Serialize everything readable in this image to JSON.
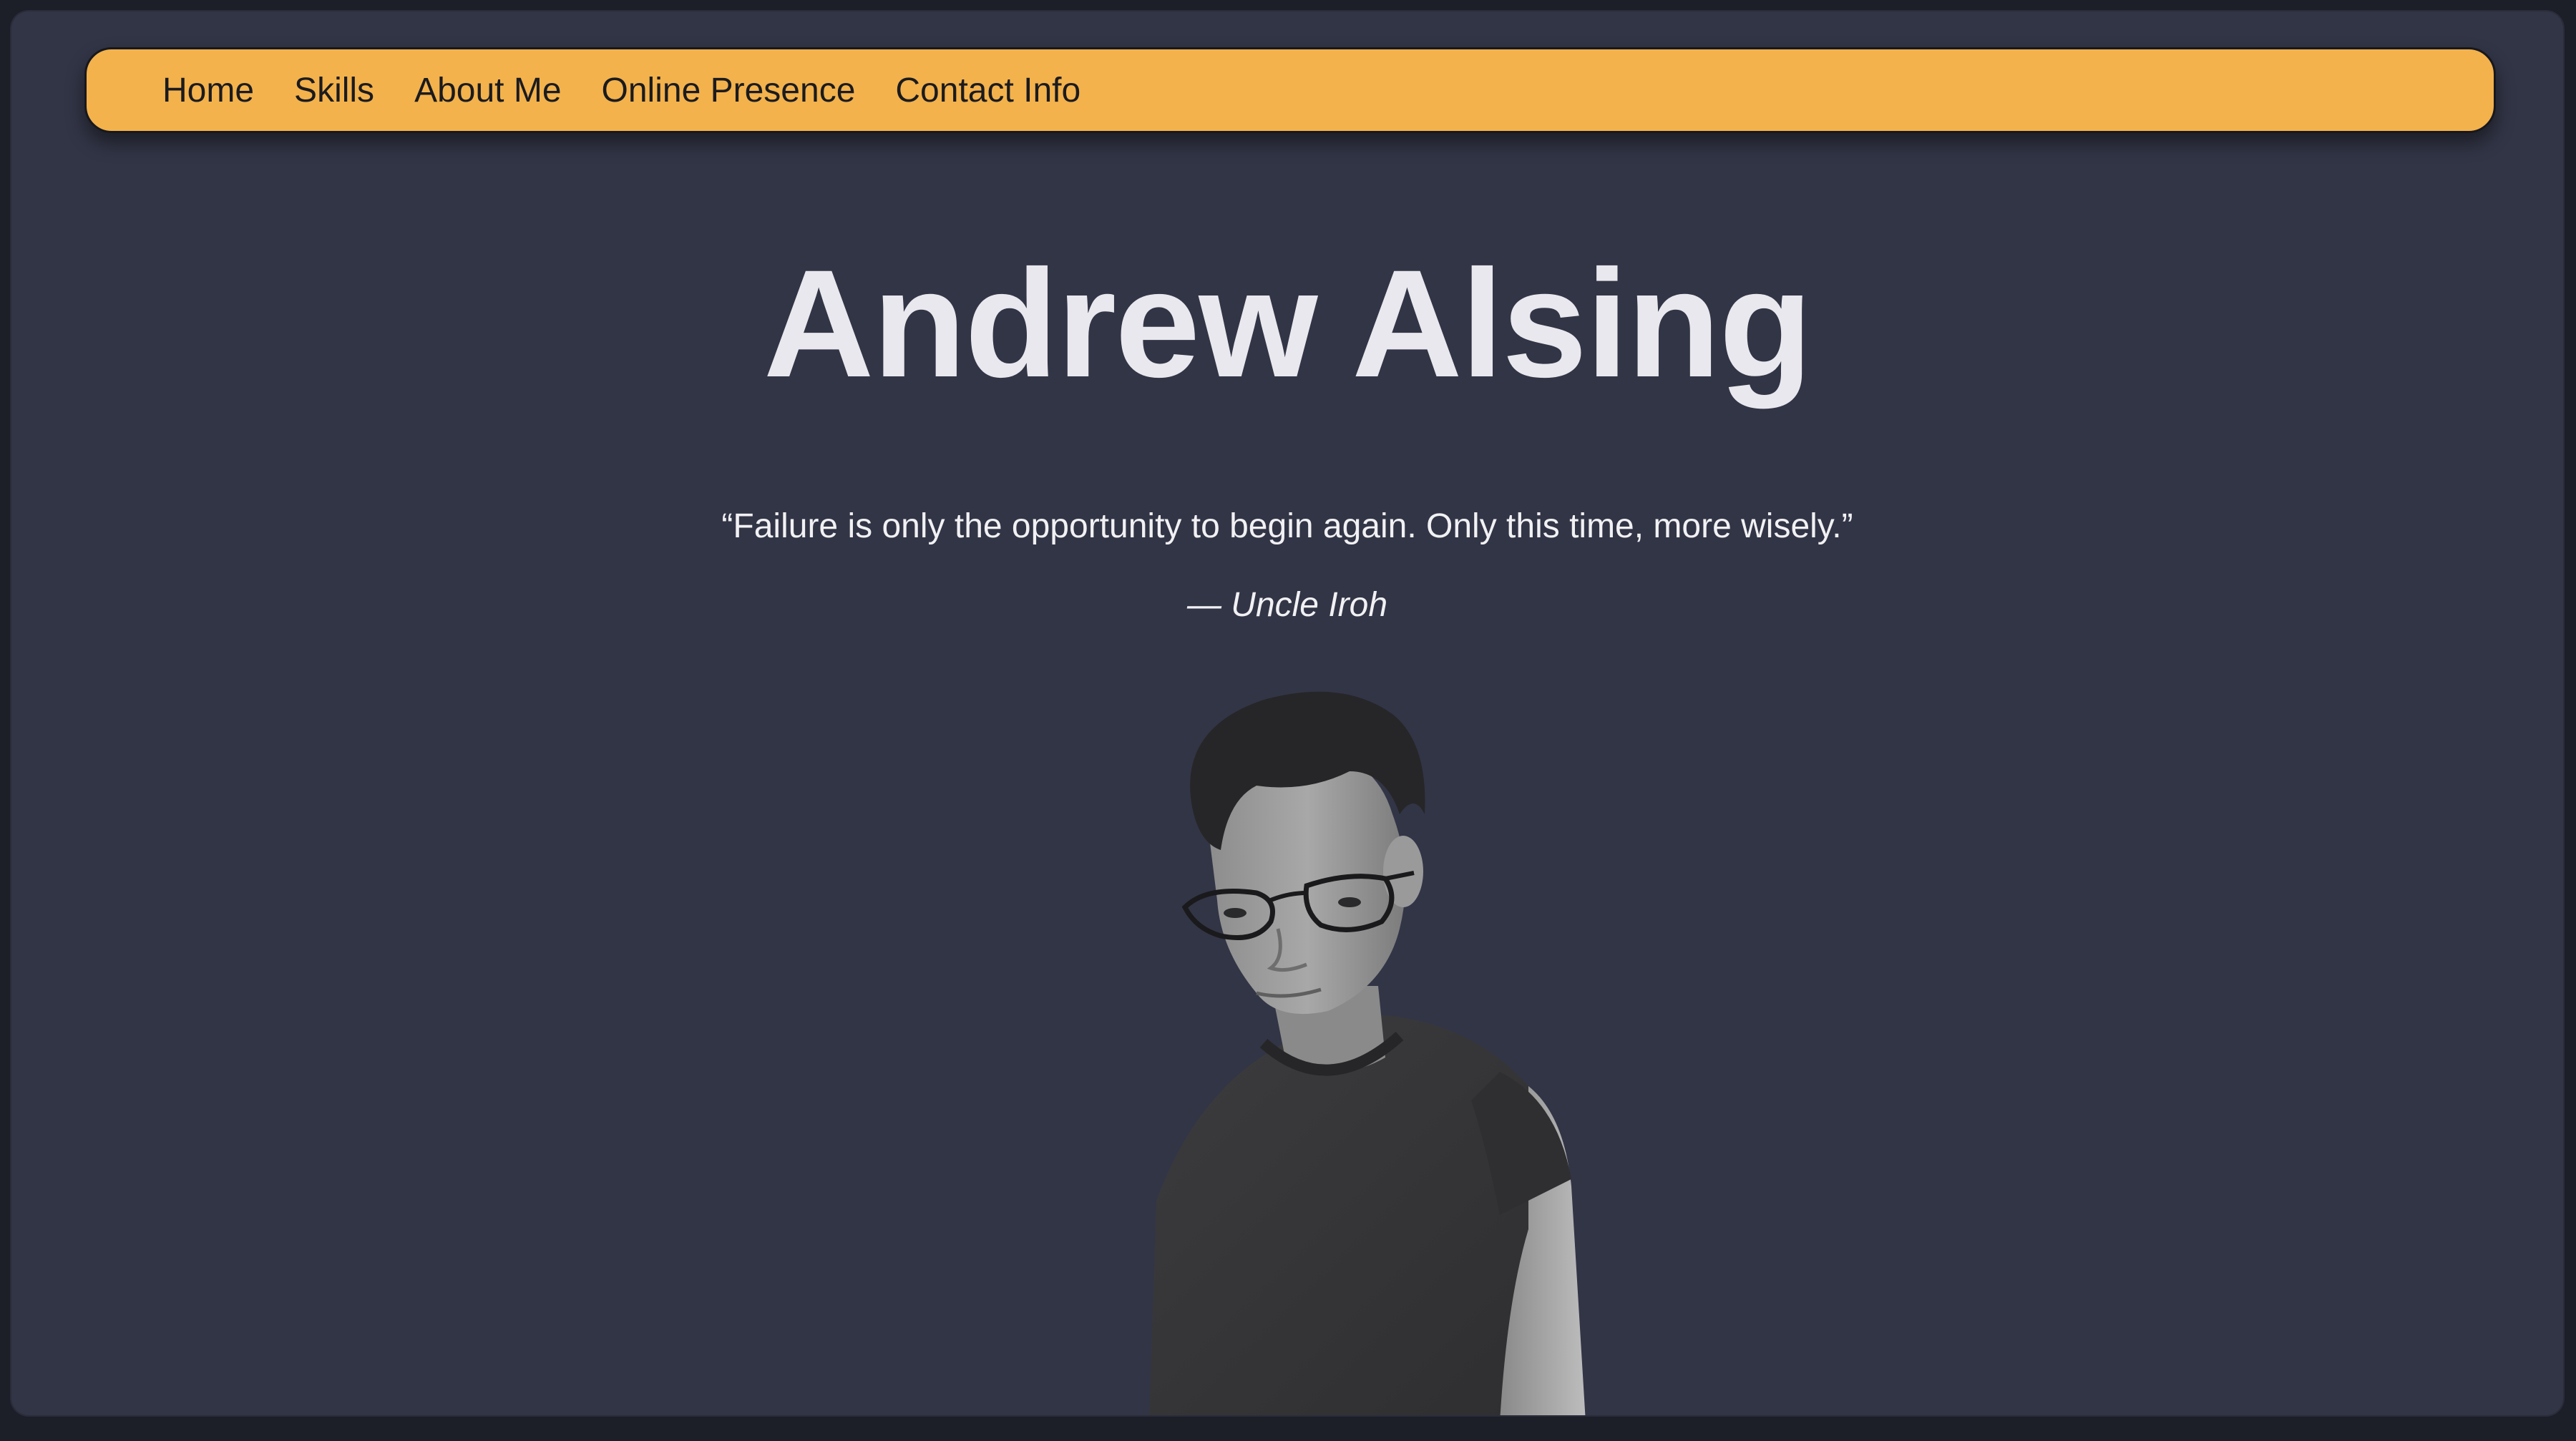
{
  "navbar": {
    "items": [
      {
        "label": "Home"
      },
      {
        "label": "Skills"
      },
      {
        "label": "About Me"
      },
      {
        "label": "Online Presence"
      },
      {
        "label": "Contact Info"
      }
    ]
  },
  "hero": {
    "title": "Andrew Alsing",
    "quote": "“Failure is only the opportunity to begin again. Only this time, more wisely.”",
    "quote_author": "— Uncle Iroh"
  },
  "colors": {
    "page_background": "#323546",
    "outer_background": "#1c1e28",
    "navbar_background": "#f3b24c",
    "title_color": "#e9e8ee"
  }
}
